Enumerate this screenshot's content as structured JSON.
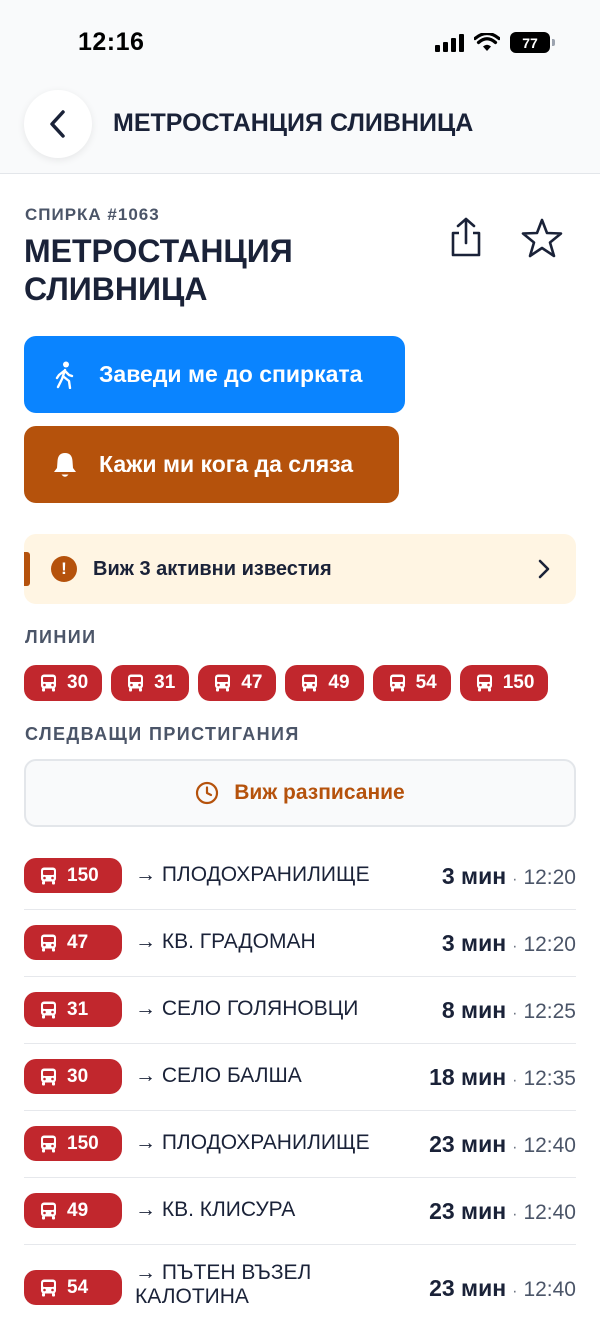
{
  "status_bar": {
    "time": "12:16",
    "battery": "77"
  },
  "header": {
    "title": "МЕТРОСТАНЦИЯ СЛИВНИЦА"
  },
  "stop": {
    "code_label": "СПИРКА #1063",
    "name": "МЕТРОСТАНЦИЯ СЛИВНИЦА"
  },
  "actions": {
    "navigate_label": "Заведи ме до спирката",
    "alert_label": "Кажи ми кога да сляза"
  },
  "alerts": {
    "label": "Виж 3 активни известия"
  },
  "lines_section": {
    "label": "ЛИНИИ",
    "lines": [
      "30",
      "31",
      "47",
      "49",
      "54",
      "150"
    ]
  },
  "arrivals_section": {
    "label": "СЛЕДВАЩИ ПРИСТИГАНИЯ",
    "schedule_label": "Виж разписание",
    "rows": [
      {
        "line": "150",
        "destination": "→ ПЛОДОХРАНИЛИЩЕ",
        "eta": "3 мин",
        "time": "12:20"
      },
      {
        "line": "47",
        "destination": "→ КВ. ГРАДОМАН",
        "eta": "3 мин",
        "time": "12:20"
      },
      {
        "line": "31",
        "destination": "→ СЕЛО ГОЛЯНОВЦИ",
        "eta": "8 мин",
        "time": "12:25"
      },
      {
        "line": "30",
        "destination": "→ СЕЛО БАЛША",
        "eta": "18 мин",
        "time": "12:35"
      },
      {
        "line": "150",
        "destination": "→ ПЛОДОХРАНИЛИЩЕ",
        "eta": "23 мин",
        "time": "12:40"
      },
      {
        "line": "49",
        "destination": "→ КВ. КЛИСУРА",
        "eta": "23 мин",
        "time": "12:40"
      },
      {
        "line": "54",
        "destination": "→ ПЪТЕН ВЪЗЕЛ КАЛОТИНА",
        "eta": "23 мин",
        "time": "12:40"
      }
    ]
  },
  "colors": {
    "primary_blue": "#0a84ff",
    "alert_orange": "#b5520c",
    "line_red": "#c1272d",
    "banner_bg": "#fff5e3",
    "text_dark": "#1a2238"
  },
  "icons": {
    "back": "chevron-left-icon",
    "share": "share-icon",
    "favorite": "star-icon",
    "navigate": "walking-person-icon",
    "alert": "bell-icon",
    "alerts_banner": "exclamation-icon",
    "bus": "bus-icon",
    "schedule": "clock-icon"
  }
}
